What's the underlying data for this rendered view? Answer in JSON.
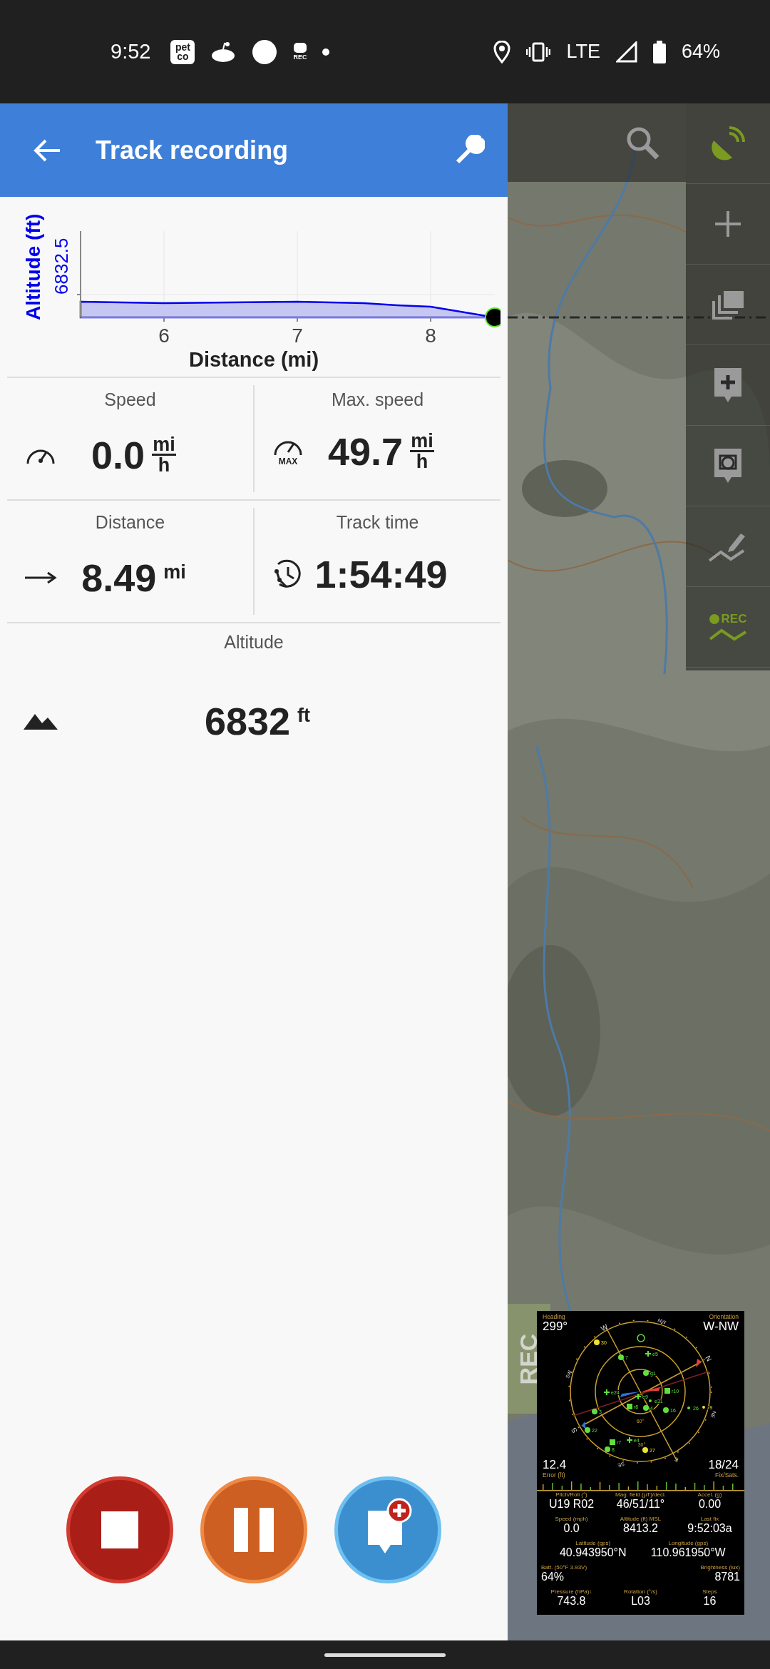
{
  "status_bar": {
    "time": "9:52",
    "petco_logo": [
      "pet",
      "co"
    ],
    "rec_badge": "REC",
    "network": "LTE",
    "battery": "64%"
  },
  "header": {
    "title": "Track recording"
  },
  "altitude_chart": {
    "y_axis_title": "Altitude (ft)",
    "y_tick": "6832.5",
    "x_ticks": [
      "6",
      "7",
      "8"
    ],
    "x_axis_title": "Distance (mi)"
  },
  "stats": [
    {
      "kind": "speed",
      "label": "Speed",
      "value": "0.0",
      "unit": [
        "mi",
        "h"
      ]
    },
    {
      "kind": "max_speed",
      "label": "Max. speed",
      "value": "49.7",
      "unit": [
        "mi",
        "h"
      ],
      "icon_text": "MAX"
    },
    {
      "kind": "distance",
      "label": "Distance",
      "value": "8.49",
      "unit": [
        "mi"
      ]
    },
    {
      "kind": "time",
      "label": "Track time",
      "value": "1:54:49"
    },
    {
      "kind": "altitude",
      "label": "Altitude",
      "value": "6832",
      "unit": [
        "ft"
      ]
    }
  ],
  "controls": [
    {
      "kind": "stop"
    },
    {
      "kind": "pause"
    },
    {
      "kind": "waypoint"
    }
  ],
  "map": {
    "rec_widget": "REC",
    "toolbar": [
      {
        "kind": "satellite",
        "active": true
      },
      {
        "kind": "zoom_in",
        "active": false
      },
      {
        "kind": "layers",
        "active": false
      },
      {
        "kind": "add_point",
        "active": false
      },
      {
        "kind": "camera",
        "active": false
      },
      {
        "kind": "draw",
        "active": false
      },
      {
        "kind": "rec",
        "active": true,
        "label": "REC"
      }
    ]
  },
  "gps_widget": {
    "heading": {
      "label": "Heading",
      "value": "299°"
    },
    "orientation": {
      "label": "Orientation",
      "value": "W-NW"
    },
    "error": {
      "label": "Error (ft)",
      "value": "12.4"
    },
    "fix": {
      "label": "Fix/Sats.",
      "value": "18/24"
    },
    "compass_labels": [
      "W",
      "NW",
      "SW",
      "S",
      "N",
      "NE",
      "SE",
      "E",
      "60°",
      "30°"
    ],
    "satellites": [
      {
        "label": "30",
        "kind": "circle",
        "color": "#f0e030"
      },
      {
        "label": "7",
        "kind": "circle",
        "color": "#60e040"
      },
      {
        "label": "e5",
        "kind": "plus",
        "color": "#60e040"
      },
      {
        "label": "g1",
        "kind": "circle",
        "color": "#60e040"
      },
      {
        "label": "e24",
        "kind": "plus",
        "color": "#60e040"
      },
      {
        "label": "r10",
        "kind": "square",
        "color": "#60e040"
      },
      {
        "label": "e9",
        "kind": "plus",
        "color": "#60e040"
      },
      {
        "label": "e31",
        "kind": "dot",
        "color": "#60e040"
      },
      {
        "label": "r8",
        "kind": "square",
        "color": "#60e040"
      },
      {
        "label": "4",
        "kind": "circle",
        "color": "#60e040"
      },
      {
        "label": "16",
        "kind": "circle",
        "color": "#60e040"
      },
      {
        "label": "3",
        "kind": "circle",
        "color": "#60e040"
      },
      {
        "label": "22",
        "kind": "circle",
        "color": "#60e040"
      },
      {
        "label": "r7",
        "kind": "square",
        "color": "#60e040"
      },
      {
        "label": "e4",
        "kind": "plus",
        "color": "#60e040"
      },
      {
        "label": "8",
        "kind": "circle",
        "color": "#60e040"
      },
      {
        "label": "27",
        "kind": "circle",
        "color": "#f0e030"
      },
      {
        "label": "26",
        "kind": "dot",
        "color": "#60e040"
      },
      {
        "label": "r9",
        "kind": "dot",
        "color": "#f0e030"
      }
    ],
    "readings": [
      {
        "kind": "three",
        "cells": [
          {
            "label": "Pitch/Roll (°)",
            "value": "U19 R02"
          },
          {
            "label": "Mag. field (µT)/decl.",
            "value": "46/51/11°"
          },
          {
            "label": "Accel. (g)",
            "value": "0.00"
          }
        ]
      },
      {
        "kind": "three",
        "cells": [
          {
            "label": "Speed (mph)",
            "value": "0.0"
          },
          {
            "label": "Altitude (ft) MSL",
            "value": "8413.2"
          },
          {
            "label": "Last fix",
            "value": "9:52:03a"
          }
        ]
      },
      {
        "kind": "two",
        "cells": [
          {
            "label": "Latitude (gps)",
            "value": "40.943950°N"
          },
          {
            "label": "Longitude (gps)",
            "value": "110.961950°W"
          }
        ]
      },
      {
        "kind": "edges",
        "cells": [
          {
            "label": "Batt. (50°F 3.93V)",
            "value": "64%"
          },
          {
            "label": "Brightness (lux)",
            "value": "8781"
          }
        ]
      },
      {
        "kind": "three",
        "cells": [
          {
            "label": "Pressure (hPa)↓",
            "value": "743.8"
          },
          {
            "label": "Rotation (°/s)",
            "value": "L03"
          },
          {
            "label": "Steps",
            "value": "16"
          }
        ]
      }
    ]
  }
}
